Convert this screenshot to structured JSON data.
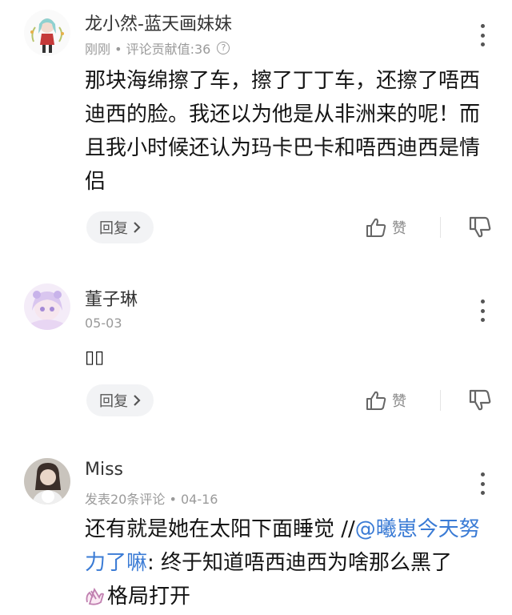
{
  "comments": [
    {
      "username": "龙小然-蓝天画妹妹",
      "meta": "刚刚 • 评论贡献值:36",
      "text": "那块海绵擦了车，擦了丁丁车，还擦了唔西迪西的脸。我还以为他是从非洲来的呢！而且我小时候还认为玛卡巴卡和唔西迪西是情侣",
      "reply_label": "回复",
      "like_label": "赞"
    },
    {
      "username": "董子琳",
      "meta": "05-03",
      "text": "▯▯",
      "reply_label": "回复",
      "like_label": "赞"
    },
    {
      "username": "Miss",
      "meta": "发表20条评论 • 04-16",
      "text_before": "还有就是她在太阳下面睡觉 //",
      "mention": "@曦崽今天努力了嘛",
      "text_after": ": 终于知道唔西迪西为啥那么黑了",
      "text_tail": "格局打开"
    }
  ],
  "colors": {
    "mention": "#3a7bd5",
    "meta": "#9a9a9a",
    "reply_bg": "#f2f3f5"
  }
}
